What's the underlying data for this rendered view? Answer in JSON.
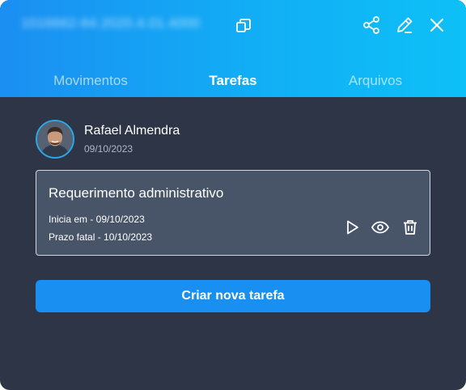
{
  "header": {
    "case_number": "1016662-84.2020.4.01.4000"
  },
  "tabs": [
    {
      "label": "Movimentos",
      "active": false
    },
    {
      "label": "Tarefas",
      "active": true
    },
    {
      "label": "Arquivos",
      "active": false
    }
  ],
  "author": {
    "name": "Rafael Almendra",
    "date": "09/10/2023"
  },
  "task": {
    "title": "Requerimento administrativo",
    "start": "Inicia em - 09/10/2023",
    "deadline": "Prazo fatal - 10/10/2023"
  },
  "actions": {
    "create_label": "Criar nova tarefa"
  },
  "colors": {
    "accent": "#1a8ff2",
    "header_start": "#1b8ff2",
    "header_end": "#0dc0f7",
    "panel_bg": "#2e3546",
    "card_bg": "#485467"
  },
  "icons": [
    "copy-icon",
    "share-icon",
    "edit-icon",
    "close-icon",
    "play-icon",
    "eye-icon",
    "trash-icon"
  ]
}
